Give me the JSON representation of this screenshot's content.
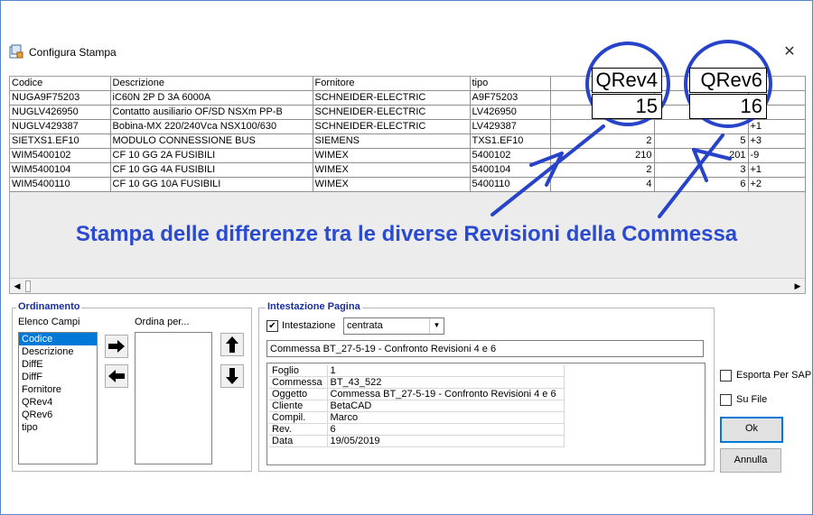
{
  "window": {
    "title": "Configura Stampa",
    "close": "✕"
  },
  "grid": {
    "columns": [
      "Codice",
      "Descrizione",
      "Fornitore",
      "tipo",
      "",
      "",
      ""
    ],
    "rows": [
      [
        "NUGA9F75203",
        "iC60N 2P D   3A 6000A",
        "SCHNEIDER-ELECTRIC",
        "A9F75203",
        "",
        "",
        ""
      ],
      [
        "NUGLV426950",
        "Contatto ausiliario OF/SD NSXm PP-B",
        "SCHNEIDER-ELECTRIC",
        "LV426950",
        "",
        "",
        ""
      ],
      [
        "NUGLV429387",
        "Bobina-MX 220/240Vca NSX100/630",
        "SCHNEIDER-ELECTRIC",
        "LV429387",
        "",
        "",
        "+1"
      ],
      [
        "SIETXS1.EF10",
        "MODULO CONNESSIONE BUS",
        "SIEMENS",
        "TXS1.EF10",
        "2",
        "5",
        "+3"
      ],
      [
        "WIM5400102",
        "CF 10 GG   2A  FUSIBILI",
        "WIMEX",
        "5400102",
        "210",
        "201",
        "-9"
      ],
      [
        "WIM5400104",
        "CF 10 GG   4A  FUSIBILI",
        "WIMEX",
        "5400104",
        "2",
        "3",
        "+1"
      ],
      [
        "WIM5400110",
        "CF 10 GG  10A  FUSIBILI",
        "WIMEX",
        "5400110",
        "4",
        "6",
        "+2"
      ]
    ]
  },
  "callouts": {
    "qrev4": {
      "header": "QRev4",
      "value": "15"
    },
    "qrev6": {
      "header": "QRev6",
      "value": "16"
    },
    "color": "#2643c9"
  },
  "annotation": "Stampa delle differenze tra le diverse Revisioni della Commessa",
  "ordinamento": {
    "label": "Ordinamento",
    "fields_label": "Elenco Campi",
    "order_label": "Ordina per...",
    "fields": [
      "Codice",
      "Descrizione",
      "DiffE",
      "DiffF",
      "Fornitore",
      "QRev4",
      "QRev6",
      "tipo"
    ],
    "selected": "Codice"
  },
  "intestazione": {
    "label": "Intestazione Pagina",
    "checkbox_label": "Intestazione",
    "checked": true,
    "align_value": "centrata",
    "title_value": "Commessa BT_27-5-19 - Confronto Revisioni 4 e 6",
    "info": [
      [
        "Foglio",
        "1"
      ],
      [
        "Commessa",
        "BT_43_522"
      ],
      [
        "Oggetto",
        "Commessa BT_27-5-19 - Confronto Revisioni 4 e 6"
      ],
      [
        "Cliente",
        "BetaCAD"
      ],
      [
        "Compil.",
        "Marco"
      ],
      [
        "Rev.",
        "6"
      ],
      [
        "Data",
        "19/05/2019"
      ]
    ]
  },
  "options": {
    "esporta": "Esporta Per SAP",
    "su_file": "Su File",
    "ok": "Ok",
    "annulla": "Annulla"
  }
}
